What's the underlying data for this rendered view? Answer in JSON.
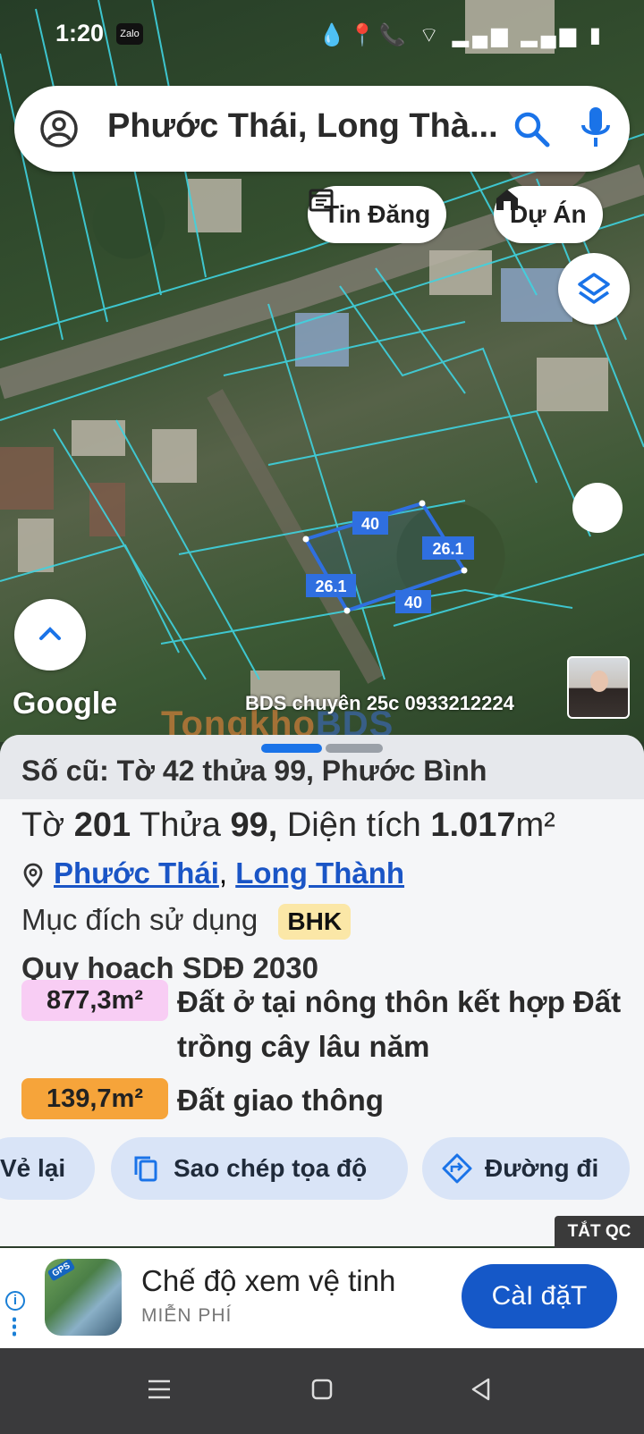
{
  "status_bar": {
    "time": "1:20",
    "notif_app": "Zalo",
    "icons": "💧📍📞 ⌔ ▂▄▆ ▂▄▆ ▮"
  },
  "search": {
    "query": "Phước Thái, Long Thà...",
    "icons": [
      "account-icon",
      "search-icon",
      "mic-icon"
    ]
  },
  "chips": [
    {
      "label": "Tin Đăng",
      "icon": "calendar-icon"
    },
    {
      "label": "Dự Án",
      "icon": "house-icon"
    }
  ],
  "map": {
    "parcel_edges": [
      "40",
      "26.1",
      "26.1",
      "40"
    ],
    "attribution": "Google",
    "ad_credit": "BDS chuyên 25c 0933212224",
    "watermark_left": "Tongkho",
    "watermark_right": "BDS",
    "colors": {
      "parcel": "#2f6fe0",
      "lot_lines": "#3fd3e0"
    }
  },
  "sheet": {
    "old_record": "Số cũ: Tờ 42 thửa 99, Phước Bình",
    "parcel": {
      "sheet_label": "Tờ",
      "sheet_no": "201",
      "lot_label": "Thửa",
      "lot_no": "99,",
      "area_label": "Diện tích",
      "area_value": "1.017",
      "area_unit": "m²"
    },
    "location": {
      "ward": "Phước Thái",
      "sep": ",",
      "district": "Long Thành"
    },
    "purpose_label": "Mục đích sử dụng",
    "purpose_code": "BHK",
    "plan_title": "Quy hoạch SDĐ 2030",
    "zones": [
      {
        "area": "877,3m²",
        "desc": "Đất ở tại nông thôn kết hợp Đất trồng cây lâu năm",
        "color": "#f8cdf4"
      },
      {
        "area": "139,7m²",
        "desc": "Đất giao thông",
        "color": "#f6a43a"
      }
    ],
    "actions": [
      {
        "label": "Vẻ lại"
      },
      {
        "label": "Sao chép tọa độ",
        "icon": "copy-icon"
      },
      {
        "label": "Đường đi",
        "icon": "directions-icon"
      }
    ]
  },
  "ad": {
    "close_label": "TẮT QC",
    "title": "Chế độ xem vệ tinh",
    "subtitle": "MIỄN PHÍ",
    "install_label": "CàI đặT",
    "app_badge": "GPS",
    "info_glyph": "i"
  },
  "nav": {
    "icons": [
      "menu-icon",
      "home-icon",
      "back-icon"
    ]
  }
}
